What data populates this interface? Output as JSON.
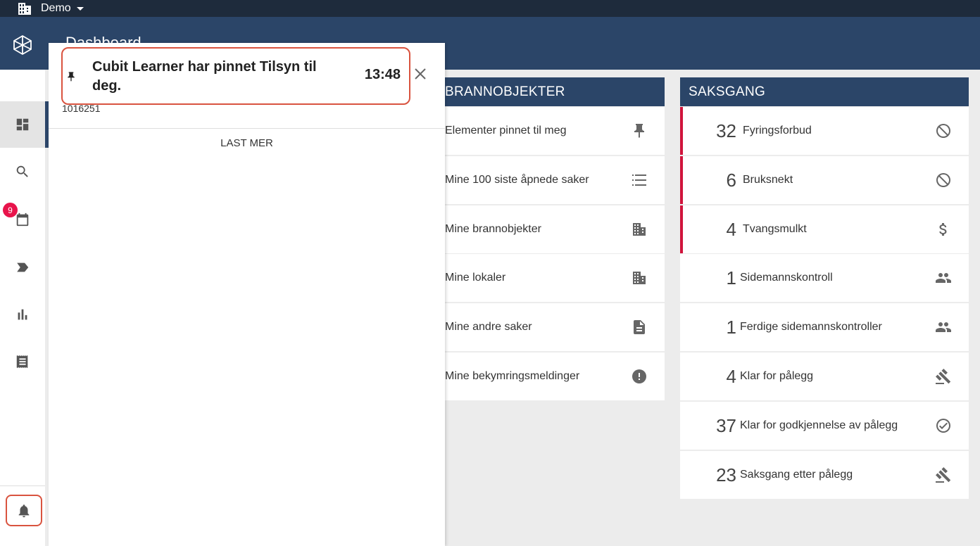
{
  "orgbar": {
    "org_name": "Demo"
  },
  "header": {
    "page_title": "Dashboard"
  },
  "sidenav": {
    "calendar_badge": "9",
    "items": [
      {
        "name": "dashboard"
      },
      {
        "name": "search"
      },
      {
        "name": "calendar"
      },
      {
        "name": "label"
      },
      {
        "name": "statistics"
      },
      {
        "name": "receipt"
      }
    ]
  },
  "objekter": {
    "title": "BRANNOBJEKTER",
    "rows": [
      {
        "label": "Elementer pinnet til meg",
        "icon": "pin-icon"
      },
      {
        "label": "Mine 100 siste åpnede saker",
        "icon": "list-icon"
      },
      {
        "label": "Mine brannobjekter",
        "icon": "building-icon"
      },
      {
        "label": "Mine lokaler",
        "icon": "building-icon"
      },
      {
        "label": "Mine andre saker",
        "icon": "document-icon"
      },
      {
        "label": "Mine bekymringsmeldinger",
        "icon": "alert-icon"
      }
    ]
  },
  "saksgang": {
    "title": "SAKSGANG",
    "rows": [
      {
        "count": "32",
        "label": "Fyringsforbud",
        "icon": "block-icon",
        "alert": true
      },
      {
        "count": "6",
        "label": "Bruksnekt",
        "icon": "block-icon",
        "alert": true
      },
      {
        "count": "4",
        "label": "Tvangsmulkt",
        "icon": "dollar-icon",
        "alert": true
      },
      {
        "count": "1",
        "label": "Sidemannskontroll",
        "icon": "people-icon",
        "alert": false
      },
      {
        "count": "1",
        "label": "Ferdige sidemannskontroller",
        "icon": "people-icon",
        "alert": false
      },
      {
        "count": "4",
        "label": "Klar for pålegg",
        "icon": "gavel-icon",
        "alert": false
      },
      {
        "count": "37",
        "label": "Klar for godkjennelse av pålegg",
        "icon": "check-circle-icon",
        "alert": false
      },
      {
        "count": "23",
        "label": "Saksgang etter pålegg",
        "icon": "gavel-icon",
        "alert": false
      }
    ]
  },
  "notifications": {
    "items": [
      {
        "text": "Cubit Learner har pinnet Tilsyn til deg.",
        "time": "13:48",
        "sub": "1016251"
      }
    ],
    "load_more": "LAST MER"
  },
  "colors": {
    "header": "#2b4568",
    "topbar": "#1e2b3c",
    "badge": "#e8144b",
    "alert_bar": "#d0143c",
    "highlight": "#d9533f"
  }
}
